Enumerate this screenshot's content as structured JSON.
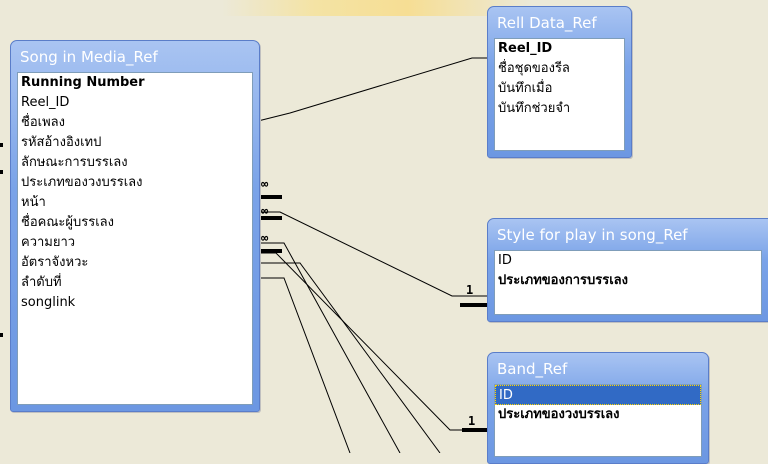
{
  "tables": {
    "song": {
      "title": "Song in Media_Ref",
      "fields": [
        {
          "name": "Running Number",
          "key": true
        },
        {
          "name": "Reel_ID"
        },
        {
          "name": "ชื่อเพลง"
        },
        {
          "name": "รหัสอ้างอิงเทป"
        },
        {
          "name": "ลักษณะการบรรเลง"
        },
        {
          "name": "ประเภทของวงบรรเลง"
        },
        {
          "name": "หน้า"
        },
        {
          "name": "ชื่อคณะผู้บรรเลง"
        },
        {
          "name": "ความยาว"
        },
        {
          "name": "อัตราจังหวะ"
        },
        {
          "name": "ลำดับที่"
        },
        {
          "name": "songlink"
        }
      ]
    },
    "reel": {
      "title": "Rell Data_Ref",
      "fields": [
        {
          "name": "Reel_ID",
          "key": true
        },
        {
          "name": "ชื่อชุดของรีล"
        },
        {
          "name": "บันทึกเมื่อ"
        },
        {
          "name": "บันทึกช่วยจำ"
        }
      ]
    },
    "style": {
      "title": "Style for play in song_Ref",
      "fields": [
        {
          "name": "ID"
        },
        {
          "name": "ประเภทของการบรรเลง",
          "key": true
        }
      ]
    },
    "band": {
      "title": "Band_Ref",
      "fields": [
        {
          "name": "ID",
          "selected": true
        },
        {
          "name": "ประเภทของวงบรรเลง",
          "key": true
        }
      ]
    }
  },
  "cardinality": {
    "many": "∞",
    "one": "1"
  }
}
